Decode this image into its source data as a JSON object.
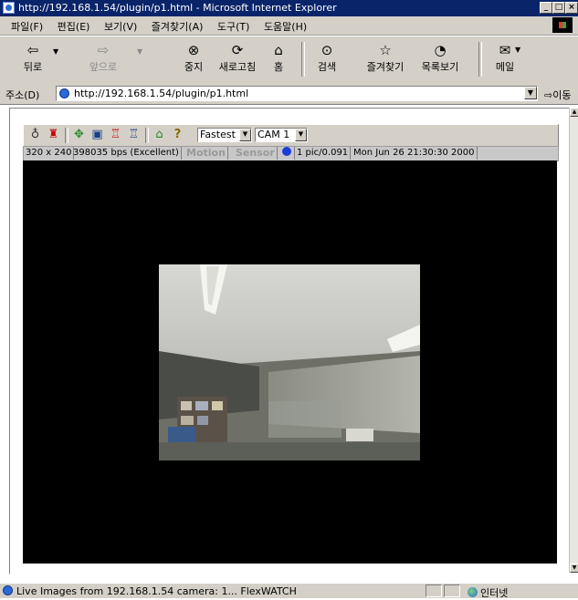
{
  "window": {
    "title": "http://192.168.1.54/plugin/p1.html - Microsoft Internet Explorer",
    "controls": [
      "_",
      "□",
      "×"
    ]
  },
  "menu": {
    "items": [
      "파일(F)",
      "편집(E)",
      "보기(V)",
      "즐겨찾기(A)",
      "도구(T)",
      "도움말(H)"
    ]
  },
  "toolbar": {
    "back": "뒤로",
    "forward": "앞으로",
    "stop": "중지",
    "refresh": "새로고침",
    "home": "홈",
    "search": "검색",
    "favorites": "즐겨찾기",
    "history": "목록보기",
    "mail": "메일"
  },
  "address": {
    "label": "주소(D)",
    "url": "http://192.168.1.54/plugin/p1.html",
    "go": "이동"
  },
  "viewer": {
    "speed_selected": "Fastest",
    "camera_selected": "CAM 1",
    "resolution": "320 x 240",
    "bitrate": "398035 bps (Excellent)",
    "motion": "Motion",
    "sensor": "Sensor",
    "framerate": "1 pic/0.091",
    "timestamp": "Mon Jun 26 21:30:30 2000"
  },
  "statusbar": {
    "text": "Live Images from 192.168.1.54   camera: 1...   FlexWATCH",
    "zone": "인터넷"
  },
  "colors": {
    "titlebar": "#0a246a",
    "chrome": "#d4d0c8",
    "video_bg": "#000000"
  }
}
